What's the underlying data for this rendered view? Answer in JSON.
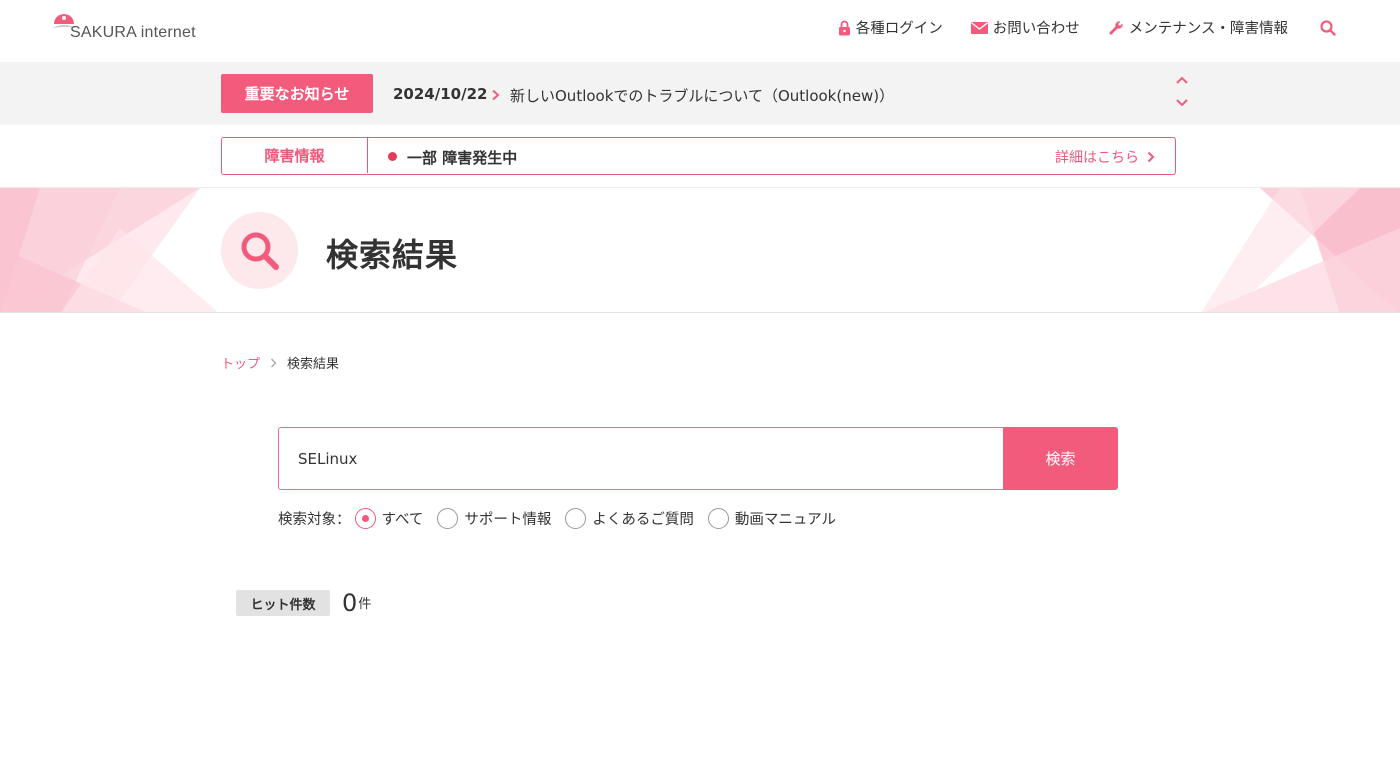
{
  "header": {
    "logo_text": "SAKURA internet",
    "nav": [
      {
        "label": "各種ログイン",
        "icon": "lock-icon"
      },
      {
        "label": "お問い合わせ",
        "icon": "mail-icon"
      },
      {
        "label": "メンテナンス・障害情報",
        "icon": "wrench-icon"
      }
    ]
  },
  "notice": {
    "badge": "重要なお知らせ",
    "date": "2024/10/22",
    "text": "新しいOutlookでのトラブルについて（Outlook(new)）"
  },
  "status": {
    "label": "障害情報",
    "text": "一部 障害発生中",
    "link": "詳細はこちら"
  },
  "hero": {
    "title": "検索結果"
  },
  "breadcrumb": {
    "top": "トップ",
    "current": "検索結果"
  },
  "search": {
    "value": "SELinux",
    "button": "検索",
    "target_label": "検索対象：",
    "options": [
      "すべて",
      "サポート情報",
      "よくあるご質問",
      "動画マニュアル"
    ],
    "selected": "すべて"
  },
  "hits": {
    "label": "ヒット件数",
    "count": "0",
    "unit": "件"
  },
  "colors": {
    "accent": "#f35b7d",
    "alert_dot": "#e53c56"
  }
}
